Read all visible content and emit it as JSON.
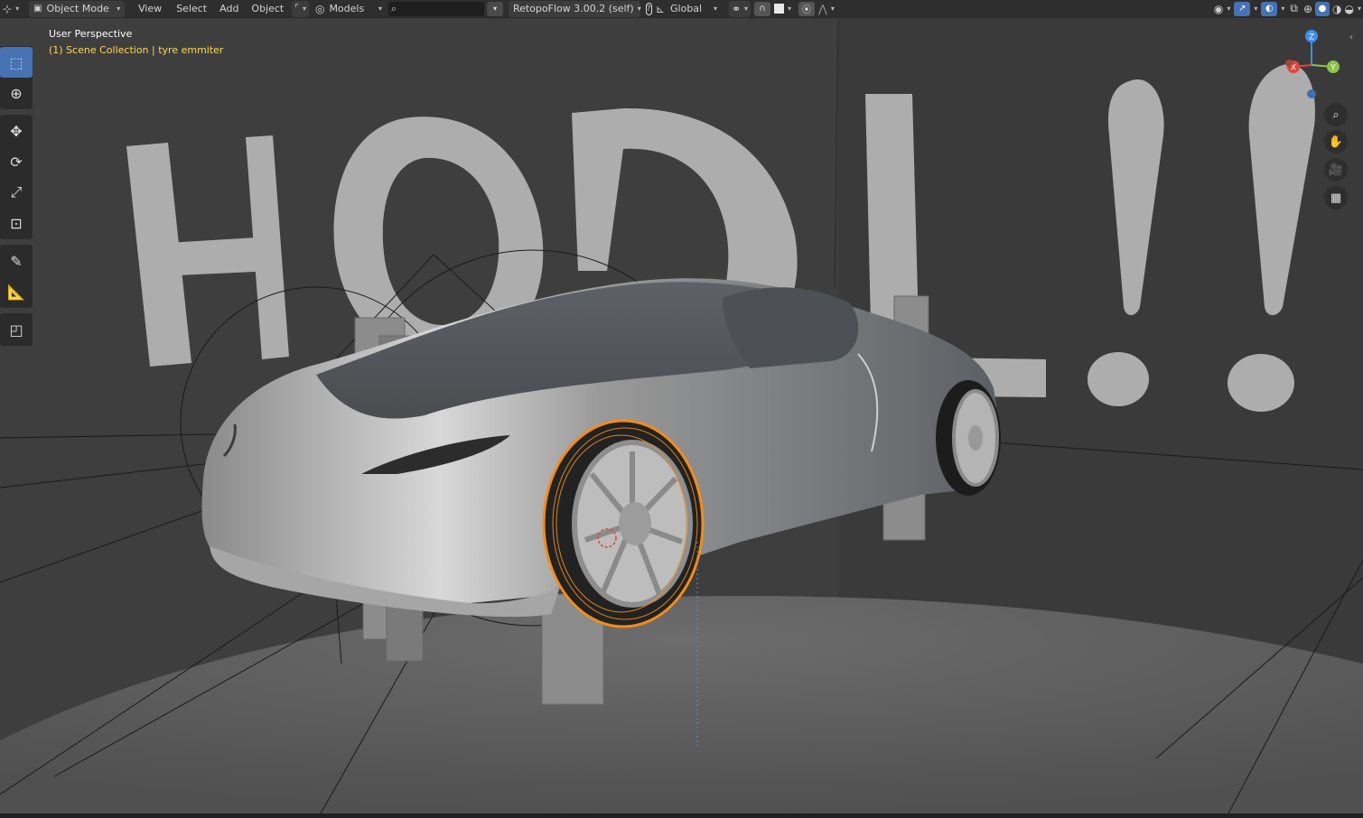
{
  "header": {
    "editor_type_icon": "editor-type-icon",
    "mode_label": "Object Mode",
    "menus": [
      "View",
      "Select",
      "Add",
      "Object"
    ],
    "collection_label": "Models",
    "addon_label": "RetopoFlow 3.00.2 (self)",
    "transform_orientation": "Global"
  },
  "viewport": {
    "perspective_label": "User Perspective",
    "collection_path": "(1) Scene Collection | tyre emmiter",
    "backdrop_text": "HODL !!"
  },
  "gizmo": {
    "x_label": "X",
    "y_label": "Y",
    "z_label": "Z"
  },
  "colors": {
    "accent": "#4772b3",
    "selection": "#f28c1c",
    "overlay_sub": "#ffd75a",
    "x_axis": "#e0433a",
    "y_axis": "#8bc34a",
    "z_axis": "#3e8ef0"
  },
  "toolbar_tools": [
    "select-box-tool",
    "cursor-tool",
    "move-tool",
    "rotate-tool",
    "scale-tool",
    "transform-tool",
    "annotate-tool",
    "measure-tool",
    "add-shape-tool"
  ],
  "nav_buttons": [
    "zoom-icon",
    "pan-hand-icon",
    "camera-icon",
    "perspective-grid-icon"
  ]
}
